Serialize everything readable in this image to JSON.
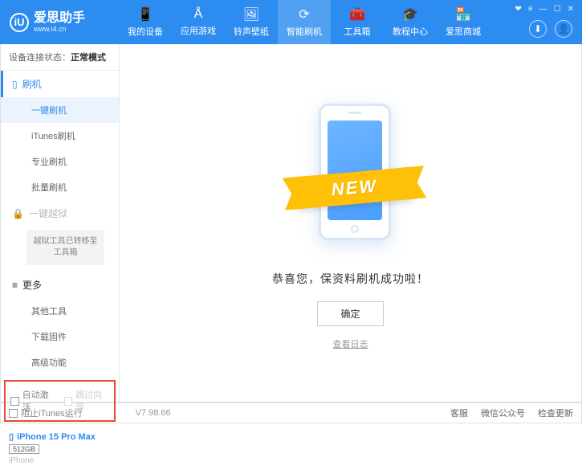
{
  "app": {
    "name": "爱思助手",
    "url": "www.i4.cn",
    "logo_letter": "iU"
  },
  "window_controls": {
    "gift": "❤",
    "menu": "≡",
    "min": "—",
    "max": "☐",
    "close": "✕"
  },
  "nav": [
    {
      "label": "我的设备",
      "icon": "📱"
    },
    {
      "label": "应用游戏",
      "icon": "Å"
    },
    {
      "label": "铃声壁纸",
      "icon": "🖼"
    },
    {
      "label": "智能刷机",
      "icon": "⟳",
      "active": true
    },
    {
      "label": "工具箱",
      "icon": "🧰"
    },
    {
      "label": "教程中心",
      "icon": "🎓"
    },
    {
      "label": "爱思商城",
      "icon": "🏪"
    }
  ],
  "header_icons": {
    "download": "⬇",
    "user": "👤"
  },
  "connection": {
    "label": "设备连接状态：",
    "status": "正常模式"
  },
  "sidebar": {
    "flash_header": "刷机",
    "flash_items": [
      "一键刷机",
      "iTunes刷机",
      "专业刷机",
      "批量刷机"
    ],
    "jailbreak_header": "一键越狱",
    "jailbreak_note": "越狱工具已转移至工具箱",
    "more_header": "更多",
    "more_items": [
      "其他工具",
      "下载固件",
      "高级功能"
    ],
    "checkbox1": "自动激活",
    "checkbox2": "跳过向导"
  },
  "device": {
    "name": "iPhone 15 Pro Max",
    "storage": "512GB",
    "type": "iPhone"
  },
  "main": {
    "banner": "NEW",
    "success": "恭喜您，保资料刷机成功啦！",
    "confirm": "确定",
    "view_log": "查看日志"
  },
  "footer": {
    "block_itunes": "阻止iTunes运行",
    "version": "V7.98.66",
    "links": [
      "客服",
      "微信公众号",
      "检查更新"
    ]
  }
}
